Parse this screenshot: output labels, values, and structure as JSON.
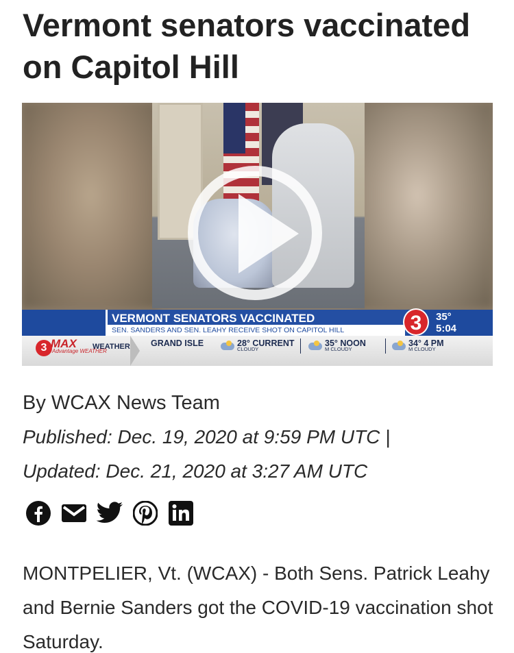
{
  "article": {
    "headline": "Vermont senators vaccinated on Capitol Hill",
    "byline": "By WCAX News Team",
    "published": "Published: Dec. 19, 2020 at 9:59 PM UTC  |",
    "updated": "Updated: Dec. 21, 2020 at 3:27 AM UTC",
    "body": "MONTPELIER, Vt. (WCAX) - Both Sens. Patrick Leahy and Bernie Sanders got the COVID-19 vaccination shot Saturday."
  },
  "video": {
    "lower_third_title": "VERMONT SENATORS VACCINATED",
    "lower_third_sub": "SEN. SANDERS AND SEN. LEAHY RECEIVE SHOT ON CAPITOL HILL",
    "channel_logo": "3",
    "temp": "35°",
    "time": "5:04",
    "weather": {
      "brand": "MAX",
      "brand_sub": "Advantage WEATHER",
      "label": "WEATHER",
      "region": "GRAND ISLE",
      "cells": [
        {
          "value": "28° CURRENT",
          "condition": "CLOUDY"
        },
        {
          "value": "35° NOON",
          "condition": "M CLOUDY"
        },
        {
          "value": "34° 4 PM",
          "condition": "M CLOUDY"
        }
      ]
    }
  },
  "share_icons": [
    "facebook-icon",
    "email-icon",
    "twitter-icon",
    "pinterest-icon",
    "linkedin-icon"
  ],
  "colors": {
    "accent_blue": "#1e4a9e",
    "brand_red": "#d8262b"
  }
}
